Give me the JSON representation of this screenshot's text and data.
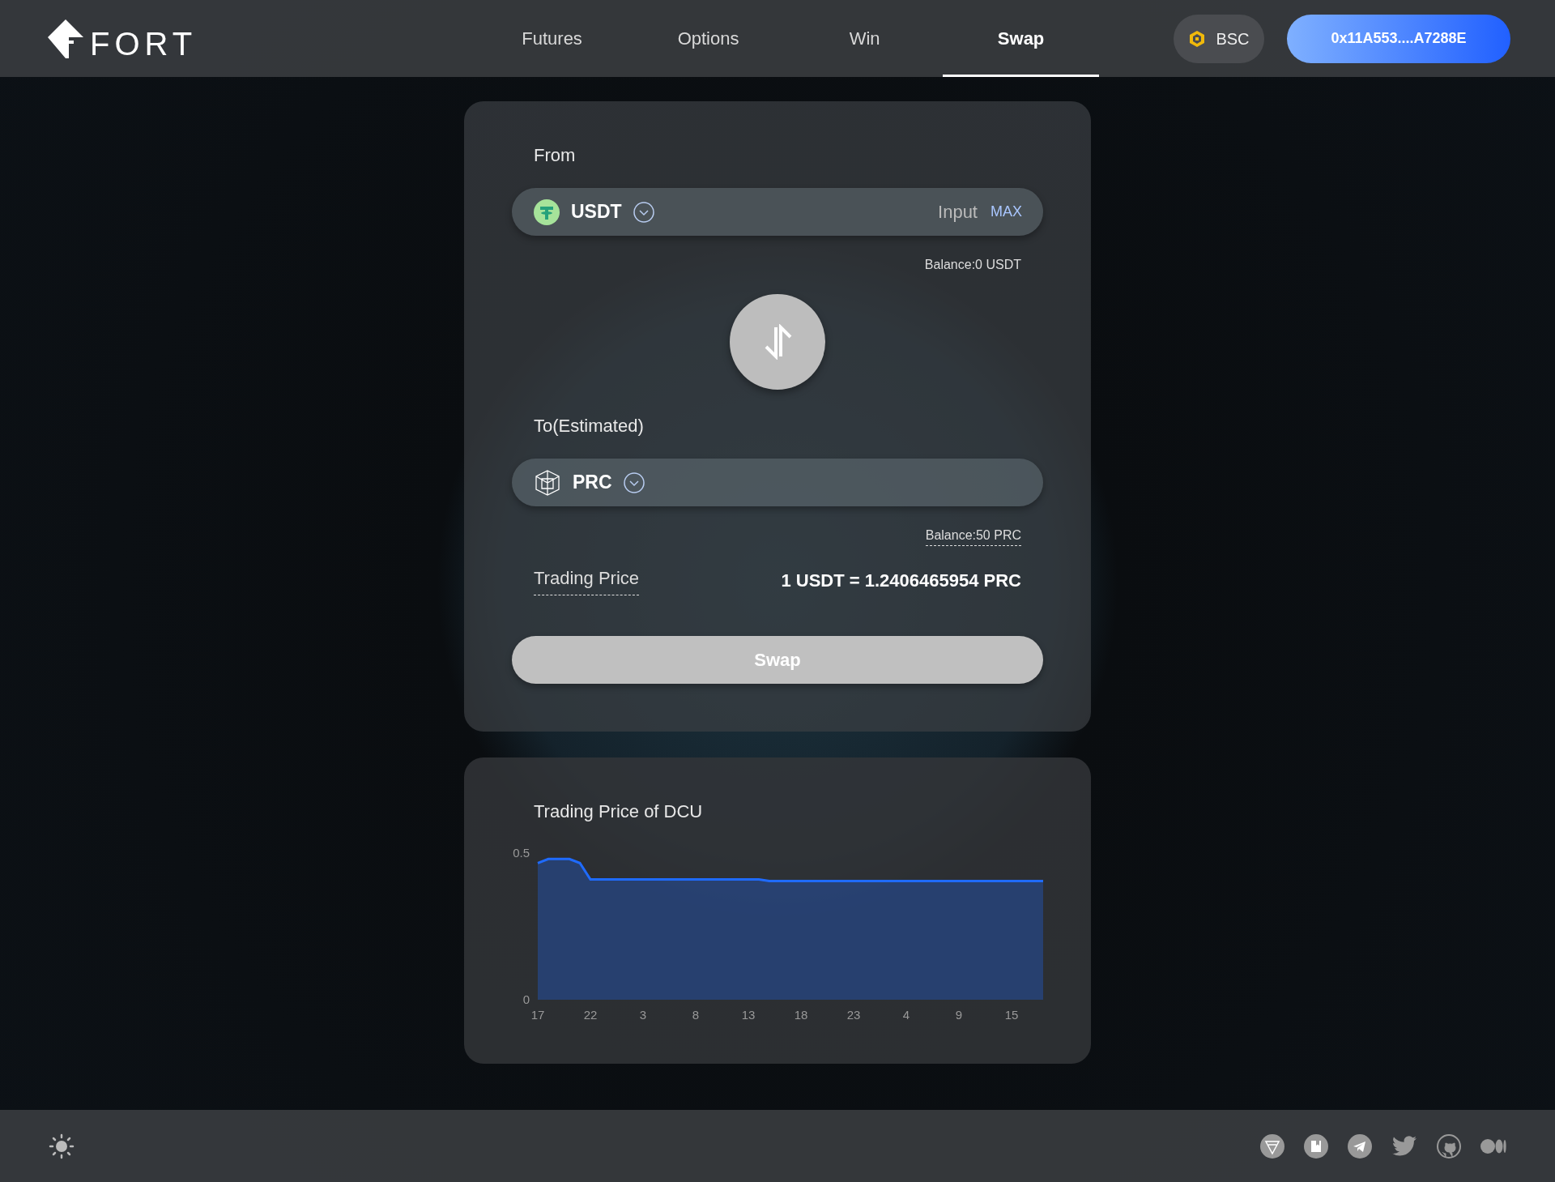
{
  "header": {
    "logo": "FORT",
    "nav": [
      {
        "label": "Futures",
        "selected": false
      },
      {
        "label": "Options",
        "selected": false
      },
      {
        "label": "Win",
        "selected": false
      },
      {
        "label": "Swap",
        "selected": true
      }
    ],
    "network": "BSC",
    "wallet": "0x11A553....A7288E"
  },
  "swap": {
    "from": {
      "label": "From",
      "token": "USDT",
      "placeholder": "Input",
      "max": "MAX",
      "balance": "Balance:0 USDT"
    },
    "to": {
      "label": "To(Estimated)",
      "token": "PRC",
      "balance": "Balance:50 PRC"
    },
    "price": {
      "label": "Trading Price",
      "value": "1 USDT = 1.2406465954 PRC"
    },
    "button": {
      "label": "Swap",
      "disabled": true
    }
  },
  "chart_card": {
    "title": "Trading Price of DCU",
    "chart_data": {
      "type": "area",
      "categories": [
        "17",
        null,
        null,
        null,
        null,
        "22",
        null,
        null,
        null,
        null,
        "3",
        null,
        null,
        null,
        null,
        "8",
        null,
        null,
        null,
        null,
        "13",
        null,
        null,
        null,
        null,
        "18",
        null,
        null,
        null,
        null,
        "23",
        null,
        null,
        null,
        null,
        "4",
        null,
        null,
        null,
        null,
        "9",
        null,
        null,
        null,
        null,
        "15",
        null,
        null,
        null
      ],
      "series": [
        {
          "color": "#1f6bff",
          "values": [
            0.466,
            0.48,
            0.48,
            0.48,
            0.466,
            0.41,
            0.41,
            0.41,
            0.41,
            0.41,
            0.41,
            0.41,
            0.41,
            0.41,
            0.41,
            0.41,
            0.41,
            0.41,
            0.41,
            0.41,
            0.41,
            0.41,
            0.405,
            0.405,
            0.405,
            0.405,
            0.405,
            0.405,
            0.405,
            0.405,
            0.405,
            0.405,
            0.405,
            0.405,
            0.405,
            0.405,
            0.405,
            0.405,
            0.405,
            0.405,
            0.405,
            0.405,
            0.405,
            0.405,
            0.405,
            0.405,
            0.405,
            0.405,
            0.405
          ]
        }
      ],
      "ylim": [
        0,
        0.5
      ],
      "yticks": [
        0,
        0.5
      ]
    }
  }
}
